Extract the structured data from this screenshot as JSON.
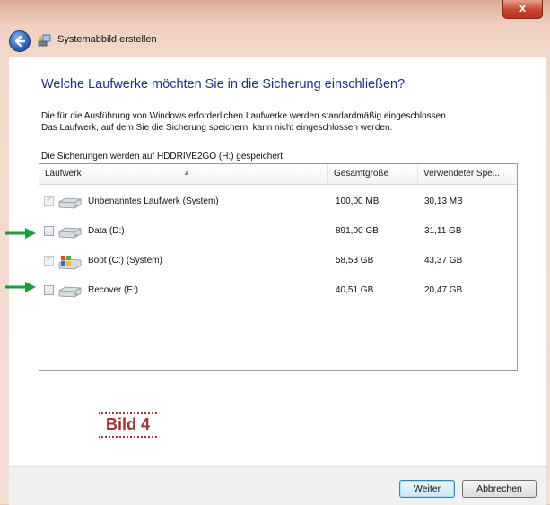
{
  "window": {
    "close_label": "x",
    "breadcrumb": "Systemabbild erstellen"
  },
  "main": {
    "heading": "Welche Laufwerke möchten Sie in die Sicherung einschließen?",
    "desc_line1": "Die für die Ausführung von Windows erforderlichen Laufwerke werden standardmäßig eingeschlossen.",
    "desc_line2": "Das Laufwerk, auf dem Sie die Sicherung speichern, kann nicht eingeschlossen werden.",
    "save_info": "Die Sicherungen werden auf HDDRIVE2GO (H:) gespeichert."
  },
  "table": {
    "columns": [
      "Laufwerk",
      "Gesamtgröße",
      "Verwendeter Spe..."
    ],
    "rows": [
      {
        "name": "Unbenanntes Laufwerk (System)",
        "total": "100,00 MB",
        "used": "30,13 MB",
        "checked": true,
        "disabled": true,
        "icon": "hard-drive-icon"
      },
      {
        "name": "Data (D:)",
        "total": "891,00 GB",
        "used": "31,11 GB",
        "checked": false,
        "disabled": false,
        "icon": "hard-drive-icon"
      },
      {
        "name": "Boot (C:) (System)",
        "total": "58,53 GB",
        "used": "43,37 GB",
        "checked": true,
        "disabled": true,
        "icon": "windows-drive-icon"
      },
      {
        "name": "Recover (E:)",
        "total": "40,51 GB",
        "used": "20,47 GB",
        "checked": false,
        "disabled": false,
        "icon": "hard-drive-icon"
      }
    ]
  },
  "annotation": {
    "label": "Bild 4",
    "arrow_color": "#1f9a3c"
  },
  "footer": {
    "next_label": "Weiter",
    "cancel_label": "Abbrechen"
  },
  "colors": {
    "heading": "#1e3287",
    "accent": "#a03335"
  }
}
